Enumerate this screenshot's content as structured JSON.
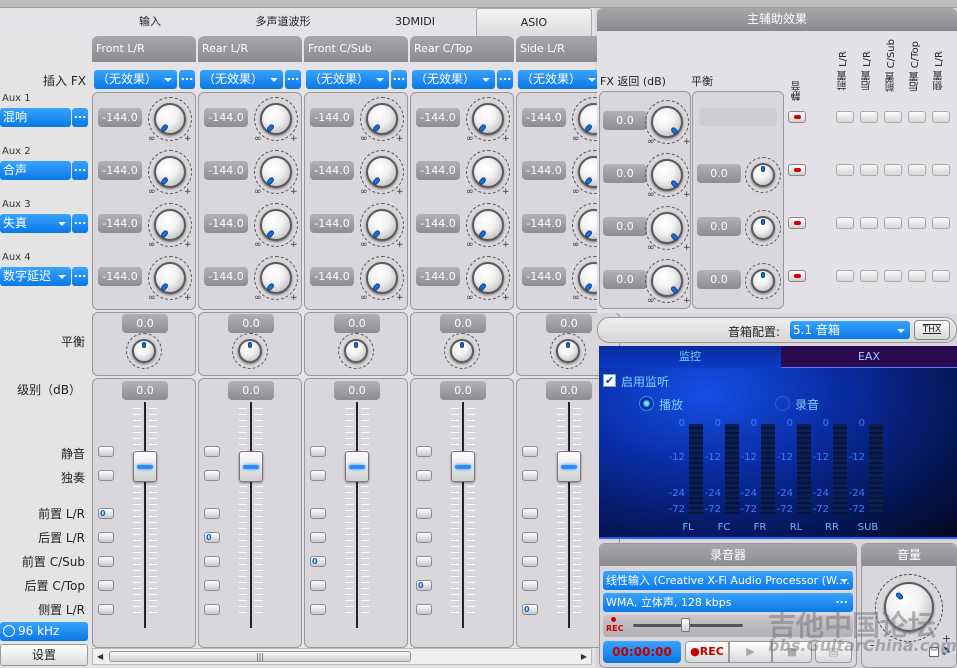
{
  "tabs": [
    {
      "label": "输入",
      "active": false
    },
    {
      "label": "多声道波形",
      "active": false
    },
    {
      "label": "3DMIDI",
      "active": false
    },
    {
      "label": "ASIO",
      "active": true
    }
  ],
  "left_labels": {
    "insert_fx": "插入 FX",
    "balance": "平衡",
    "level": "级别（dB）",
    "mute": "静音",
    "solo": "独奏",
    "routing": [
      "前置 L/R",
      "后置 L/R",
      "前置 C/Sub",
      "后置 C/Top",
      "侧置 L/R"
    ]
  },
  "aux_sends": [
    {
      "title": "Aux 1",
      "effect": "混响",
      "has_dropdown": false
    },
    {
      "title": "Aux 2",
      "effect": "合声",
      "has_dropdown": false
    },
    {
      "title": "Aux 3",
      "effect": "失真",
      "has_dropdown": true
    },
    {
      "title": "Aux 4",
      "effect": "数字延迟",
      "has_dropdown": true
    }
  ],
  "dots_label": "...",
  "knob_marks": {
    "min": "∞",
    "max": "+"
  },
  "channels": [
    {
      "name": "Front L/R",
      "insert_fx": "（无效果）",
      "aux_values": [
        "-144.0",
        "-144.0",
        "-144.0",
        "-144.0"
      ],
      "balance": "0.0",
      "level": "0.0",
      "routing_active": 0
    },
    {
      "name": "Rear L/R",
      "insert_fx": "（无效果）",
      "aux_values": [
        "-144.0",
        "-144.0",
        "-144.0",
        "-144.0"
      ],
      "balance": "0.0",
      "level": "0.0",
      "routing_active": 1
    },
    {
      "name": "Front C/Sub",
      "insert_fx": "（无效果）",
      "aux_values": [
        "-144.0",
        "-144.0",
        "-144.0",
        "-144.0"
      ],
      "balance": "0.0",
      "level": "0.0",
      "routing_active": 2
    },
    {
      "name": "Rear C/Top",
      "insert_fx": "（无效果）",
      "aux_values": [
        "-144.0",
        "-144.0",
        "-144.0",
        "-144.0"
      ],
      "balance": "0.0",
      "level": "0.0",
      "routing_active": 3
    },
    {
      "name": "Side L/R",
      "insert_fx": "（无效果）",
      "aux_values": [
        "-144.0",
        "-144.0",
        "-144.0",
        "-144.0"
      ],
      "balance": "0.0",
      "level": "0.0",
      "routing_active": 4
    }
  ],
  "sample_rate": "96 kHz",
  "settings_button": "设置",
  "master_fx": {
    "title": "主辅助效果",
    "fx_return_label": "FX 返回 (dB)",
    "balance_label": "平衡",
    "mute_label": "静音",
    "routing_labels": [
      "前置 L/R",
      "后置 L/R",
      "前置 C/Sub",
      "后置 C/Top",
      "侧置 L/R"
    ],
    "rows": [
      {
        "fx_return": "0.0",
        "balance": ""
      },
      {
        "fx_return": "0.0",
        "balance": "0.0"
      },
      {
        "fx_return": "0.0",
        "balance": "0.0"
      },
      {
        "fx_return": "0.0",
        "balance": "0.0"
      }
    ]
  },
  "speaker_config": {
    "label": "音箱配置:",
    "value": "5.1 音箱",
    "thx_button": "THX"
  },
  "monitor": {
    "tabs": [
      {
        "label": "监控",
        "active": true
      },
      {
        "label": "EAX",
        "active": false
      }
    ],
    "enable_label": "启用监听",
    "enable_checked": true,
    "radio_playback": "播放",
    "radio_record": "录音",
    "selected": "播放",
    "scale": [
      "0",
      "-12",
      "-24",
      "-72"
    ],
    "channels": [
      "FL",
      "FC",
      "FR",
      "RL",
      "RR",
      "SUB"
    ]
  },
  "recorder": {
    "title": "录音器",
    "source": "线性输入 (Creative X-Fi Audio Processor (W....",
    "format": "WMA, 立体声, 128 kbps",
    "rec_indicator": "REC",
    "time": "00:00:00",
    "rec_button": "REC"
  },
  "volume": {
    "title": "音量",
    "min": "-",
    "max": "+"
  },
  "watermark": {
    "text": "吉他中国论坛",
    "url": "bbs.GuitarChina.com"
  },
  "colors": {
    "accent_blue": "#0a78e6",
    "panel_header": "#9c999e",
    "monitor_bg": "#0a2ea8",
    "rec_red": "#c00000"
  }
}
